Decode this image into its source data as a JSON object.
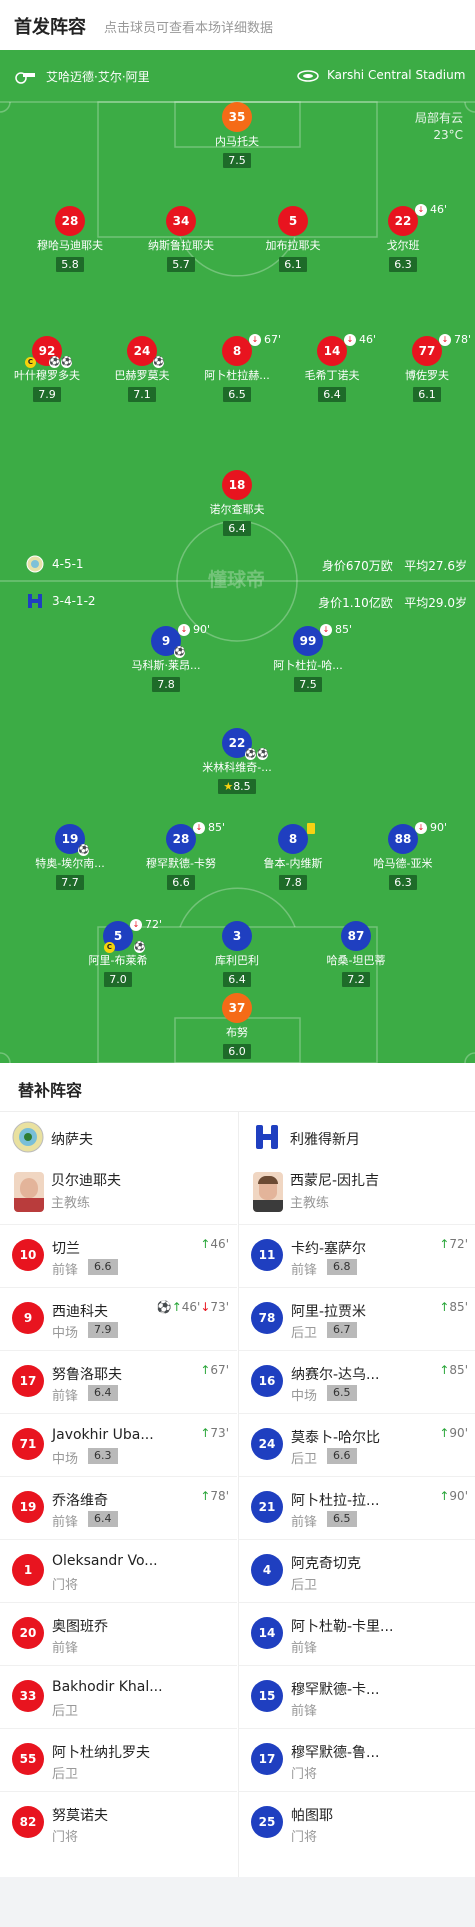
{
  "header": {
    "title": "首发阵容",
    "subtitle": "点击球员可查看本场详细数据"
  },
  "venue": {
    "referee": "艾哈迈德·艾尔·阿里",
    "stadium": "Karshi Central Stadium",
    "weather": "局部有云",
    "temperature": "23°C"
  },
  "home": {
    "formation": "4-5-1",
    "value": "身价670万欧",
    "age": "平均27.6岁"
  },
  "away": {
    "formation": "3-4-1-2",
    "value": "身价1.10亿欧",
    "age": "平均29.0岁"
  },
  "watermark": "懂球帝",
  "home_players": [
    {
      "num": "35",
      "name": "内马托夫",
      "rating": "7.5"
    },
    {
      "num": "28",
      "name": "穆哈马迪耶夫",
      "rating": "5.8"
    },
    {
      "num": "34",
      "name": "纳斯鲁拉耶夫",
      "rating": "5.7"
    },
    {
      "num": "5",
      "name": "加布拉耶夫",
      "rating": "6.1"
    },
    {
      "num": "22",
      "name": "戈尔班",
      "rating": "6.3",
      "sub": "46'"
    },
    {
      "num": "92",
      "name": "叶什穆罗多夫",
      "rating": "7.9"
    },
    {
      "num": "24",
      "name": "巴赫罗莫夫",
      "rating": "7.1"
    },
    {
      "num": "8",
      "name": "阿卜杜拉赫...",
      "rating": "6.5",
      "sub": "67'"
    },
    {
      "num": "14",
      "name": "毛希丁诺夫",
      "rating": "6.4",
      "sub": "46'"
    },
    {
      "num": "77",
      "name": "博佐罗夫",
      "rating": "6.1",
      "sub": "78'"
    },
    {
      "num": "18",
      "name": "诺尔查耶夫",
      "rating": "6.4"
    }
  ],
  "away_players": [
    {
      "num": "9",
      "name": "马科斯·莱昂...",
      "rating": "7.8",
      "sub": "90'"
    },
    {
      "num": "99",
      "name": "阿卜杜拉-哈...",
      "rating": "7.5",
      "sub": "85'"
    },
    {
      "num": "22",
      "name": "米林科维奇-...",
      "rating": "8.5"
    },
    {
      "num": "19",
      "name": "特奥-埃尔南...",
      "rating": "7.7"
    },
    {
      "num": "28",
      "name": "穆罕默德-卡努",
      "rating": "6.6",
      "sub": "85'"
    },
    {
      "num": "8",
      "name": "鲁本-内维斯",
      "rating": "7.8"
    },
    {
      "num": "88",
      "name": "哈马德-亚米",
      "rating": "6.3",
      "sub": "90'"
    },
    {
      "num": "5",
      "name": "阿里-布莱希",
      "rating": "7.0",
      "sub": "72'"
    },
    {
      "num": "3",
      "name": "库利巴利",
      "rating": "6.4"
    },
    {
      "num": "87",
      "name": "哈桑-坦巴蒂",
      "rating": "7.2"
    },
    {
      "num": "37",
      "name": "布努",
      "rating": "6.0"
    }
  ],
  "bench": {
    "title": "替补阵容",
    "left": {
      "team": "纳萨夫",
      "coach": {
        "name": "贝尔迪耶夫",
        "role": "主教练"
      },
      "players": [
        {
          "num": "10",
          "name": "切兰",
          "pos": "前锋",
          "rating": "6.6",
          "ev": "46'"
        },
        {
          "num": "9",
          "name": "西迪科夫",
          "pos": "中场",
          "rating": "7.9",
          "ev": "46'",
          "ev2": "73'"
        },
        {
          "num": "17",
          "name": "努鲁洛耶夫",
          "pos": "前锋",
          "rating": "6.4",
          "ev": "67'"
        },
        {
          "num": "71",
          "name": "Javokhir Uba...",
          "pos": "中场",
          "rating": "6.3",
          "ev": "73'"
        },
        {
          "num": "19",
          "name": "乔洛维奇",
          "pos": "前锋",
          "rating": "6.4",
          "ev": "78'"
        },
        {
          "num": "1",
          "name": "Oleksandr Vo...",
          "pos": "门将"
        },
        {
          "num": "20",
          "name": "奥图班乔",
          "pos": "前锋"
        },
        {
          "num": "33",
          "name": "Bakhodir Khal...",
          "pos": "后卫"
        },
        {
          "num": "55",
          "name": "阿卜杜纳扎罗夫",
          "pos": "后卫"
        },
        {
          "num": "82",
          "name": "努莫诺夫",
          "pos": "门将"
        }
      ]
    },
    "right": {
      "team": "利雅得新月",
      "coach": {
        "name": "西蒙尼-因扎吉",
        "role": "主教练"
      },
      "players": [
        {
          "num": "11",
          "name": "卡约-塞萨尔",
          "pos": "前锋",
          "rating": "6.8",
          "ev": "72'"
        },
        {
          "num": "78",
          "name": "阿里-拉贾米",
          "pos": "后卫",
          "rating": "6.7",
          "ev": "85'"
        },
        {
          "num": "16",
          "name": "纳赛尔-达乌...",
          "pos": "中场",
          "rating": "6.5",
          "ev": "85'"
        },
        {
          "num": "24",
          "name": "莫泰卜-哈尔比",
          "pos": "后卫",
          "rating": "6.6",
          "ev": "90'"
        },
        {
          "num": "21",
          "name": "阿卜杜拉-拉...",
          "pos": "前锋",
          "rating": "6.5",
          "ev": "90'"
        },
        {
          "num": "4",
          "name": "阿克奇切克",
          "pos": "后卫"
        },
        {
          "num": "14",
          "name": "阿卜杜勒-卡里...",
          "pos": "前锋"
        },
        {
          "num": "15",
          "name": "穆罕默德-卡...",
          "pos": "前锋"
        },
        {
          "num": "17",
          "name": "穆罕默德-鲁...",
          "pos": "门将"
        },
        {
          "num": "25",
          "name": "帕图耶",
          "pos": "门将"
        }
      ]
    }
  }
}
